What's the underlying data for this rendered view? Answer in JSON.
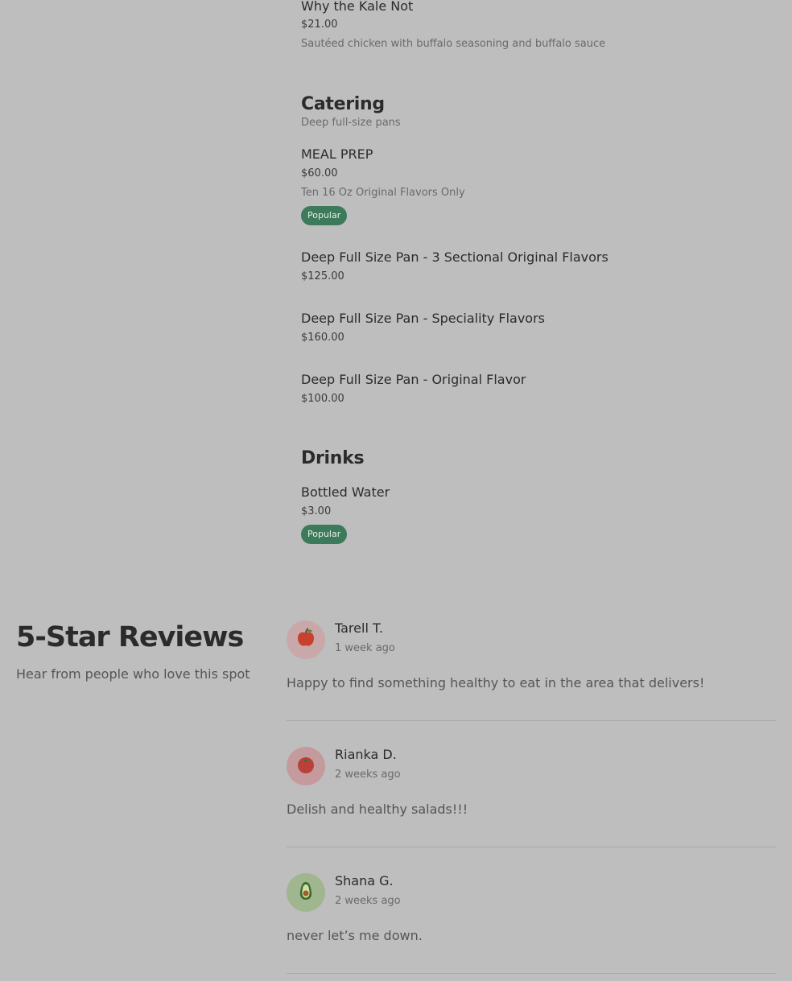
{
  "menu": {
    "top_item": {
      "name": "Why the Kale Not",
      "price": "$21.00",
      "description": "Sautéed chicken with buffalo seasoning and buffalo sauce"
    },
    "catering": {
      "title": "Catering",
      "subtitle": "Deep full-size pans",
      "items": [
        {
          "name": "MEAL PREP",
          "price": "$60.00",
          "description": "Ten 16 Oz Original Flavors Only",
          "badge": "Popular"
        },
        {
          "name": "Deep Full Size Pan - 3 Sectional Original Flavors",
          "price": "$125.00"
        },
        {
          "name": "Deep Full Size Pan - Speciality Flavors",
          "price": "$160.00"
        },
        {
          "name": "Deep Full Size Pan - Original Flavor",
          "price": "$100.00"
        }
      ]
    },
    "drinks": {
      "title": "Drinks",
      "items": [
        {
          "name": "Bottled Water",
          "price": "$3.00",
          "badge": "Popular"
        }
      ]
    }
  },
  "reviews": {
    "title": "5-Star Reviews",
    "subtitle": "Hear from people who love this spot",
    "list": [
      {
        "name": "Tarell T.",
        "date": "1 week ago",
        "text": "Happy to find something healthy to eat in the area that delivers!",
        "avatar_icon": "apple-icon",
        "avatar_bg": "#c9a8aa"
      },
      {
        "name": "Rianka D.",
        "date": "2 weeks ago",
        "text": "Delish and healthy salads!!!",
        "avatar_icon": "tomato-icon",
        "avatar_bg": "#c49a9c"
      },
      {
        "name": "Shana G.",
        "date": "2 weeks ago",
        "text": "never let’s me down.",
        "avatar_icon": "avocado-icon",
        "avatar_bg": "#9fb68e"
      }
    ]
  },
  "colors": {
    "background": "#bebebe",
    "badge": "#3b7a5a",
    "divider": "#a8a8a8"
  }
}
